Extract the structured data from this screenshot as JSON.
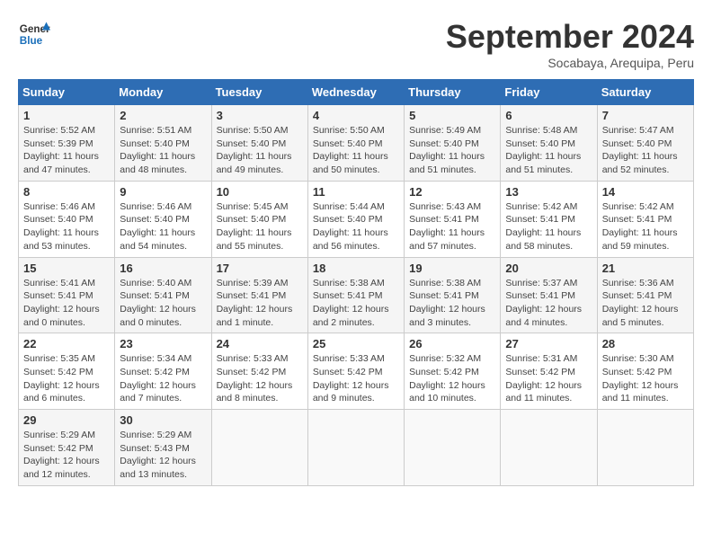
{
  "header": {
    "logo_line1": "General",
    "logo_line2": "Blue",
    "month": "September 2024",
    "location": "Socabaya, Arequipa, Peru"
  },
  "weekdays": [
    "Sunday",
    "Monday",
    "Tuesday",
    "Wednesday",
    "Thursday",
    "Friday",
    "Saturday"
  ],
  "weeks": [
    [
      {
        "day": "1",
        "info": "Sunrise: 5:52 AM\nSunset: 5:39 PM\nDaylight: 11 hours\nand 47 minutes."
      },
      {
        "day": "2",
        "info": "Sunrise: 5:51 AM\nSunset: 5:40 PM\nDaylight: 11 hours\nand 48 minutes."
      },
      {
        "day": "3",
        "info": "Sunrise: 5:50 AM\nSunset: 5:40 PM\nDaylight: 11 hours\nand 49 minutes."
      },
      {
        "day": "4",
        "info": "Sunrise: 5:50 AM\nSunset: 5:40 PM\nDaylight: 11 hours\nand 50 minutes."
      },
      {
        "day": "5",
        "info": "Sunrise: 5:49 AM\nSunset: 5:40 PM\nDaylight: 11 hours\nand 51 minutes."
      },
      {
        "day": "6",
        "info": "Sunrise: 5:48 AM\nSunset: 5:40 PM\nDaylight: 11 hours\nand 51 minutes."
      },
      {
        "day": "7",
        "info": "Sunrise: 5:47 AM\nSunset: 5:40 PM\nDaylight: 11 hours\nand 52 minutes."
      }
    ],
    [
      {
        "day": "8",
        "info": "Sunrise: 5:46 AM\nSunset: 5:40 PM\nDaylight: 11 hours\nand 53 minutes."
      },
      {
        "day": "9",
        "info": "Sunrise: 5:46 AM\nSunset: 5:40 PM\nDaylight: 11 hours\nand 54 minutes."
      },
      {
        "day": "10",
        "info": "Sunrise: 5:45 AM\nSunset: 5:40 PM\nDaylight: 11 hours\nand 55 minutes."
      },
      {
        "day": "11",
        "info": "Sunrise: 5:44 AM\nSunset: 5:40 PM\nDaylight: 11 hours\nand 56 minutes."
      },
      {
        "day": "12",
        "info": "Sunrise: 5:43 AM\nSunset: 5:41 PM\nDaylight: 11 hours\nand 57 minutes."
      },
      {
        "day": "13",
        "info": "Sunrise: 5:42 AM\nSunset: 5:41 PM\nDaylight: 11 hours\nand 58 minutes."
      },
      {
        "day": "14",
        "info": "Sunrise: 5:42 AM\nSunset: 5:41 PM\nDaylight: 11 hours\nand 59 minutes."
      }
    ],
    [
      {
        "day": "15",
        "info": "Sunrise: 5:41 AM\nSunset: 5:41 PM\nDaylight: 12 hours\nand 0 minutes."
      },
      {
        "day": "16",
        "info": "Sunrise: 5:40 AM\nSunset: 5:41 PM\nDaylight: 12 hours\nand 0 minutes."
      },
      {
        "day": "17",
        "info": "Sunrise: 5:39 AM\nSunset: 5:41 PM\nDaylight: 12 hours\nand 1 minute."
      },
      {
        "day": "18",
        "info": "Sunrise: 5:38 AM\nSunset: 5:41 PM\nDaylight: 12 hours\nand 2 minutes."
      },
      {
        "day": "19",
        "info": "Sunrise: 5:38 AM\nSunset: 5:41 PM\nDaylight: 12 hours\nand 3 minutes."
      },
      {
        "day": "20",
        "info": "Sunrise: 5:37 AM\nSunset: 5:41 PM\nDaylight: 12 hours\nand 4 minutes."
      },
      {
        "day": "21",
        "info": "Sunrise: 5:36 AM\nSunset: 5:41 PM\nDaylight: 12 hours\nand 5 minutes."
      }
    ],
    [
      {
        "day": "22",
        "info": "Sunrise: 5:35 AM\nSunset: 5:42 PM\nDaylight: 12 hours\nand 6 minutes."
      },
      {
        "day": "23",
        "info": "Sunrise: 5:34 AM\nSunset: 5:42 PM\nDaylight: 12 hours\nand 7 minutes."
      },
      {
        "day": "24",
        "info": "Sunrise: 5:33 AM\nSunset: 5:42 PM\nDaylight: 12 hours\nand 8 minutes."
      },
      {
        "day": "25",
        "info": "Sunrise: 5:33 AM\nSunset: 5:42 PM\nDaylight: 12 hours\nand 9 minutes."
      },
      {
        "day": "26",
        "info": "Sunrise: 5:32 AM\nSunset: 5:42 PM\nDaylight: 12 hours\nand 10 minutes."
      },
      {
        "day": "27",
        "info": "Sunrise: 5:31 AM\nSunset: 5:42 PM\nDaylight: 12 hours\nand 11 minutes."
      },
      {
        "day": "28",
        "info": "Sunrise: 5:30 AM\nSunset: 5:42 PM\nDaylight: 12 hours\nand 11 minutes."
      }
    ],
    [
      {
        "day": "29",
        "info": "Sunrise: 5:29 AM\nSunset: 5:42 PM\nDaylight: 12 hours\nand 12 minutes."
      },
      {
        "day": "30",
        "info": "Sunrise: 5:29 AM\nSunset: 5:43 PM\nDaylight: 12 hours\nand 13 minutes."
      },
      {
        "day": "",
        "info": ""
      },
      {
        "day": "",
        "info": ""
      },
      {
        "day": "",
        "info": ""
      },
      {
        "day": "",
        "info": ""
      },
      {
        "day": "",
        "info": ""
      }
    ]
  ]
}
